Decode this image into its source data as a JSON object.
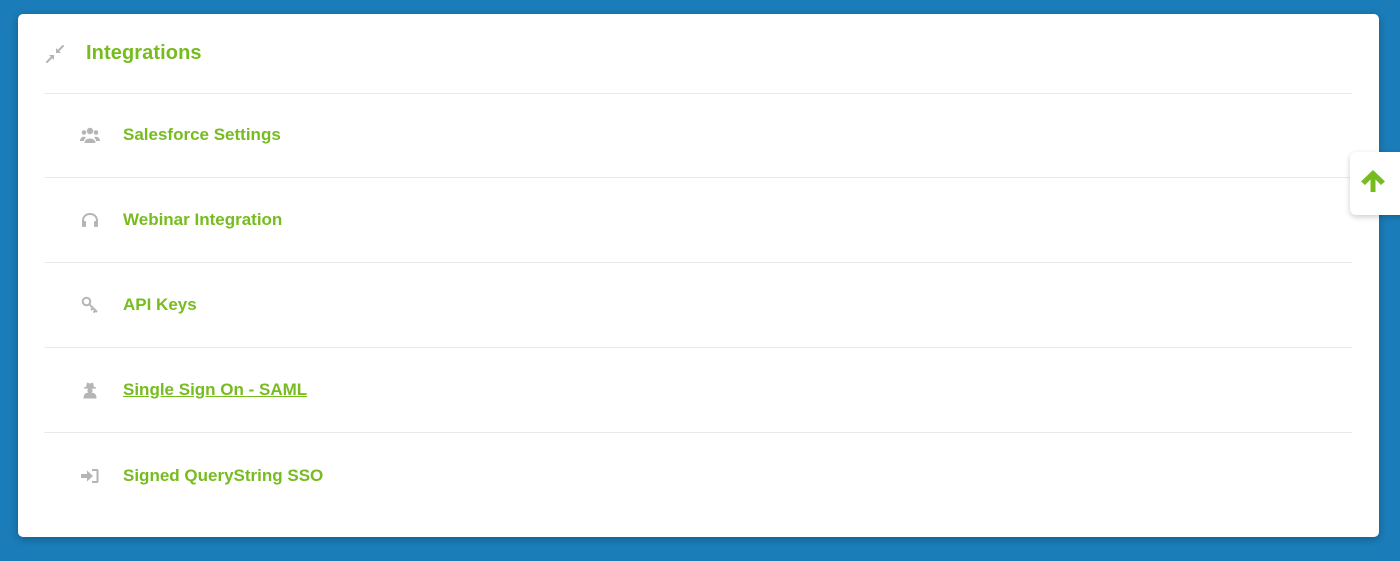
{
  "section": {
    "title": "Integrations",
    "collapse_icon": "compress-icon"
  },
  "items": [
    {
      "label": "Salesforce Settings",
      "icon": "users-icon"
    },
    {
      "label": "Webinar Integration",
      "icon": "headphones-icon"
    },
    {
      "label": "API Keys",
      "icon": "key-icon"
    },
    {
      "label": "Single Sign On - SAML",
      "icon": "user-secret-icon"
    },
    {
      "label": "Signed QueryString SSO",
      "icon": "sign-in-icon"
    }
  ],
  "scroll_top": {
    "icon": "arrow-up-icon"
  },
  "colors": {
    "background": "#1a7cb8",
    "accent": "#77bc1f",
    "icon_gray": "#b5b5b5",
    "divider": "#eaeaea"
  }
}
